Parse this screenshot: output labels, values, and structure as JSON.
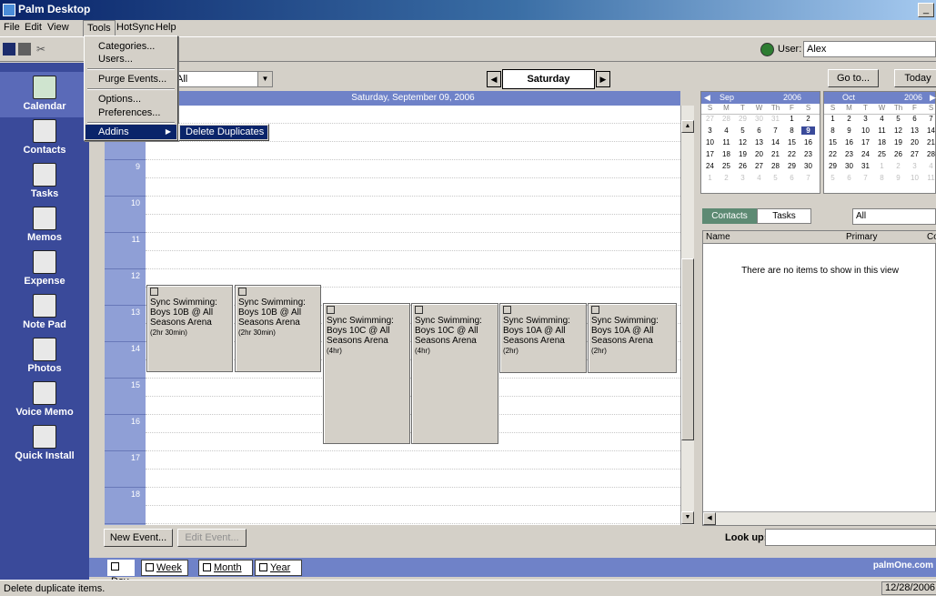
{
  "window": {
    "title": "Palm Desktop"
  },
  "menubar": {
    "file": "File",
    "edit": "Edit",
    "view": "View",
    "tools": "Tools",
    "hotsync": "HotSync",
    "help": "Help"
  },
  "tools_menu": {
    "items": [
      "Categories...",
      "Users...",
      "Purge Events...",
      "Options...",
      "Preferences...",
      "Addins"
    ],
    "submenu_item": "Delete Duplicates"
  },
  "toolbar": {
    "user_label": "User:",
    "user_value": "Alex"
  },
  "sidebar": {
    "items": [
      "Calendar",
      "Contacts",
      "Tasks",
      "Memos",
      "Expense",
      "Note Pad",
      "Photos",
      "Voice Memo",
      "Quick Install"
    ],
    "selected": "Calendar"
  },
  "calendar": {
    "category": "All",
    "day": "Saturday",
    "date_header": "Saturday, September 09, 2006",
    "hours": [
      "8",
      "9",
      "10",
      "11",
      "12",
      "13",
      "14",
      "15",
      "16",
      "17",
      "18"
    ],
    "events": [
      {
        "title": "Sync Swimming:",
        "subtitle": "Boys 10B @ All",
        "location": "Seasons Arena",
        "duration": "(2hr 30min)"
      },
      {
        "title": "Sync Swimming:",
        "subtitle": "Boys 10B @ All",
        "location": "Seasons Arena",
        "duration": "(2hr 30min)"
      },
      {
        "title": "Sync Swimming:",
        "subtitle": "Boys 10C @ All",
        "location": "Seasons Arena",
        "duration": "(4hr)"
      },
      {
        "title": "Sync Swimming:",
        "subtitle": "Boys 10C @ All",
        "location": "Seasons Arena",
        "duration": "(4hr)"
      },
      {
        "title": "Sync Swimming:",
        "subtitle": "Boys 10A @ All",
        "location": "Seasons Arena",
        "duration": "(2hr)"
      },
      {
        "title": "Sync Swimming:",
        "subtitle": "Boys 10A @ All",
        "location": "Seasons Arena",
        "duration": "(2hr)"
      }
    ],
    "buttons": {
      "new_event": "New Event...",
      "edit_event": "Edit Event..."
    }
  },
  "view_tabs": {
    "day": "Day",
    "week": "Week",
    "month": "Month",
    "year": "Year",
    "brand": "palmOne.com"
  },
  "right_pane": {
    "goto": "Go to...",
    "today": "Today",
    "sep_cal": {
      "month": "Sep",
      "year": "2006",
      "dow": [
        "S",
        "M",
        "T",
        "W",
        "Th",
        "F",
        "S"
      ],
      "rows": [
        [
          "27",
          "28",
          "29",
          "30",
          "31",
          "1",
          "2"
        ],
        [
          "3",
          "4",
          "5",
          "6",
          "7",
          "8",
          "9"
        ],
        [
          "10",
          "11",
          "12",
          "13",
          "14",
          "15",
          "16"
        ],
        [
          "17",
          "18",
          "19",
          "20",
          "21",
          "22",
          "23"
        ],
        [
          "24",
          "25",
          "26",
          "27",
          "28",
          "29",
          "30"
        ],
        [
          "1",
          "2",
          "3",
          "4",
          "5",
          "6",
          "7"
        ]
      ]
    },
    "oct_cal": {
      "month": "Oct",
      "year": "2006",
      "dow": [
        "S",
        "M",
        "T",
        "W",
        "Th",
        "F",
        "S"
      ],
      "rows": [
        [
          "1",
          "2",
          "3",
          "4",
          "5",
          "6",
          "7"
        ],
        [
          "8",
          "9",
          "10",
          "11",
          "12",
          "13",
          "14"
        ],
        [
          "15",
          "16",
          "17",
          "18",
          "19",
          "20",
          "21"
        ],
        [
          "22",
          "23",
          "24",
          "25",
          "26",
          "27",
          "28"
        ],
        [
          "29",
          "30",
          "31",
          "1",
          "2",
          "3",
          "4"
        ],
        [
          "5",
          "6",
          "7",
          "8",
          "9",
          "10",
          "11"
        ]
      ]
    },
    "tab_contacts": "Contacts",
    "tab_tasks": "Tasks",
    "filter": "All",
    "col_name": "Name",
    "col_primary": "Primary",
    "col_c": "Co",
    "empty_message": "There are no items to show in this view",
    "lookup_label": "Look up:"
  },
  "status": {
    "text": "Delete duplicate items.",
    "date": "12/28/2006"
  }
}
